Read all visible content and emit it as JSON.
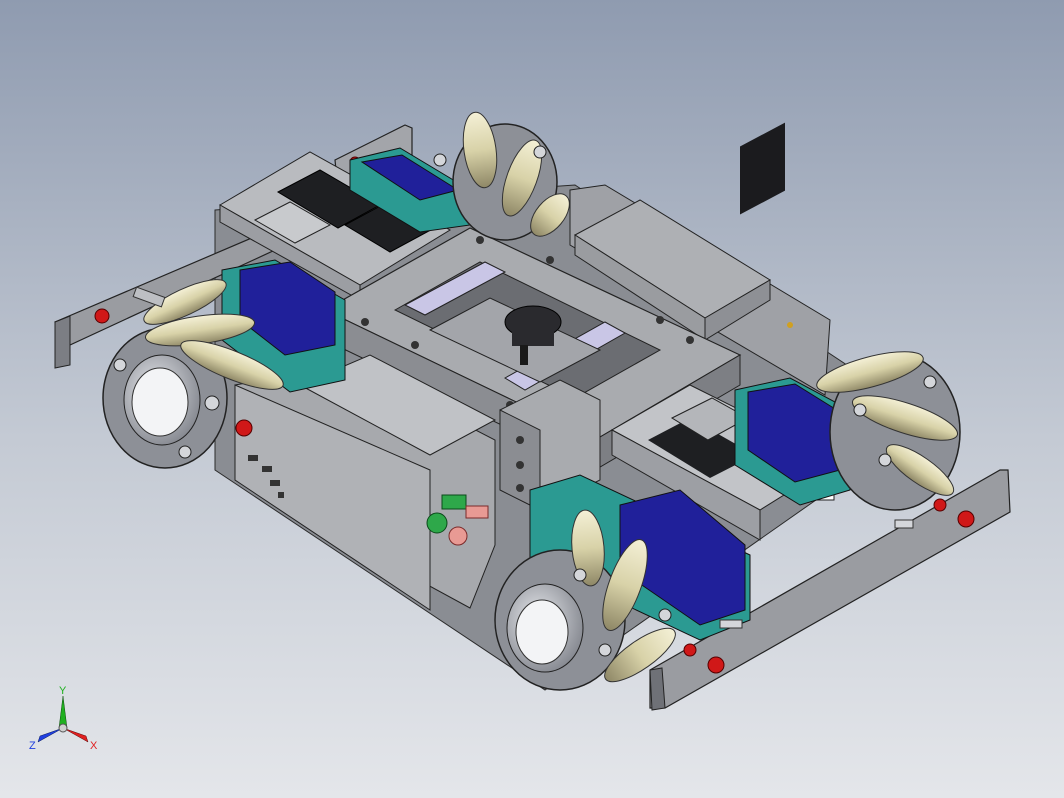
{
  "viewport": {
    "triad": {
      "x_label": "X",
      "y_label": "Y",
      "z_label": "Z"
    },
    "colors": {
      "background_top": "#8f9bb0",
      "background_bottom": "#e4e6ea",
      "frame_gray": "#a9abaf",
      "motor_blue": "#20209a",
      "bracket_teal": "#2b9a92",
      "roller_cream": "#d8d2a8",
      "button_red": "#d01818",
      "button_green": "#2ea84a",
      "button_pink": "#e89a94",
      "axis_x": "#e02020",
      "axis_y": "#20b020",
      "axis_z": "#2040e0"
    }
  }
}
